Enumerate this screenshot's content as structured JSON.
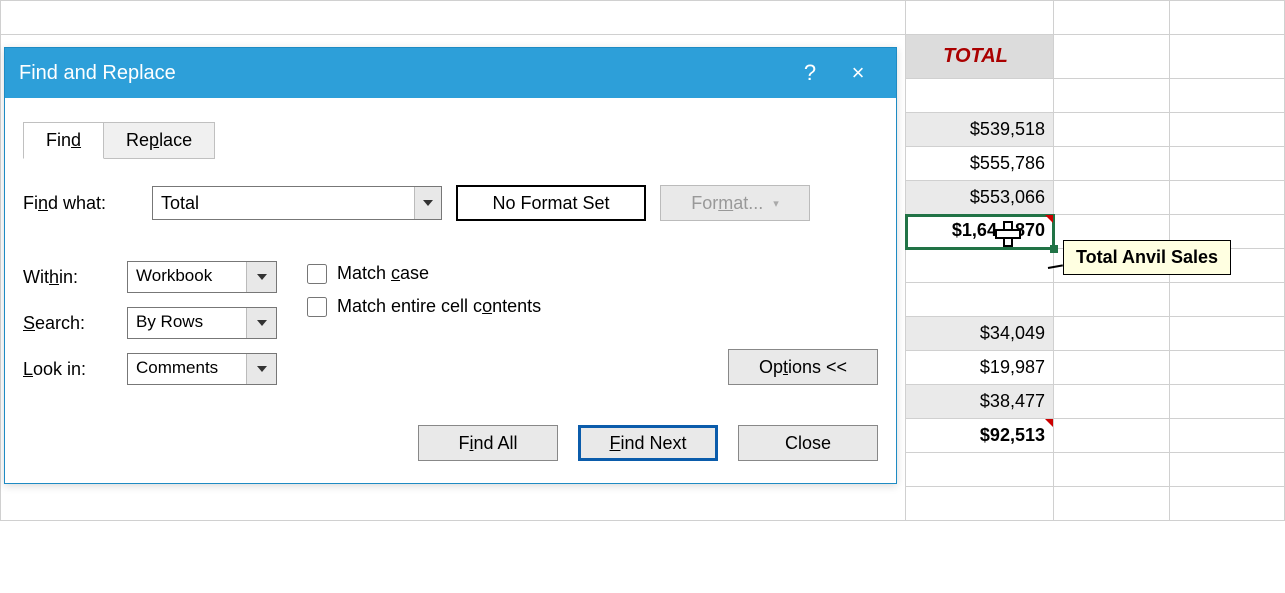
{
  "dialog": {
    "title": "Find and Replace",
    "help_symbol": "?",
    "close_symbol": "×",
    "tabs": {
      "find": "Find",
      "replace": "Replace"
    },
    "find_what_label": "Find what:",
    "find_what_value": "Total",
    "no_format_label": "No Format Set",
    "format_btn": "Format...",
    "within_label": "Within:",
    "within_value": "Workbook",
    "search_label": "Search:",
    "search_value": "By Rows",
    "lookin_label": "Look in:",
    "lookin_value": "Comments",
    "match_case": "Match case",
    "match_entire": "Match entire cell contents",
    "options_btn": "Options <<",
    "find_all_btn": "Find All",
    "find_next_btn": "Find Next",
    "close_btn": "Close"
  },
  "sheet": {
    "header": "TOTAL",
    "rows": [
      "$539,518",
      "$555,786",
      "$553,066"
    ],
    "active_prefix": "$1,64",
    "active_suffix": "870",
    "rows2": [
      "$34,049",
      "$19,987",
      "$38,477",
      "$92,513"
    ],
    "tooltip": "Total Anvil Sales"
  }
}
